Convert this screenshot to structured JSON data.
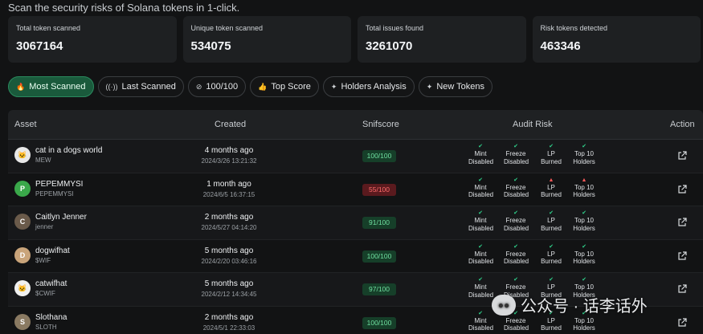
{
  "intro": "Scan the security risks of Solana tokens in 1-click.",
  "stats": [
    {
      "label": "Total token scanned",
      "value": "3067164"
    },
    {
      "label": "Unique token scanned",
      "value": "534075"
    },
    {
      "label": "Total issues found",
      "value": "3261070"
    },
    {
      "label": "Risk tokens detected",
      "value": "463346"
    }
  ],
  "filters": [
    {
      "label": "Most Scanned",
      "icon": "flame-icon",
      "active": true
    },
    {
      "label": "Last Scanned",
      "icon": "broadcast-icon",
      "active": false
    },
    {
      "label": "100/100",
      "icon": "check-circle-icon",
      "active": false
    },
    {
      "label": "Top Score",
      "icon": "thumbs-up-icon",
      "active": false
    },
    {
      "label": "Holders Analysis",
      "icon": "sparkle-icon",
      "active": false
    },
    {
      "label": "New Tokens",
      "icon": "sparkle-icon",
      "active": false
    }
  ],
  "columns": {
    "asset": "Asset",
    "created": "Created",
    "snifscore": "Snifscore",
    "audit": "Audit Risk",
    "action": "Action"
  },
  "audit_labels": {
    "mint": [
      "Mint",
      "Disabled"
    ],
    "freeze": [
      "Freeze",
      "Disabled"
    ],
    "lp": [
      "LP",
      "Burned"
    ],
    "top10": [
      "Top 10",
      "Holders"
    ]
  },
  "colors": {
    "ok": "#2fd08a",
    "warn": "#ff5a5a",
    "score_good_bg": "#163f29",
    "score_bad_bg": "#5a1a1e"
  },
  "rows": [
    {
      "name": "cat in a dogs world",
      "symbol": "MEW",
      "created_rel": "4 months ago",
      "created_abs": "2024/3/26 13:21:32",
      "score": "100/100",
      "score_status": "good",
      "audit": [
        "ok",
        "ok",
        "ok",
        "ok"
      ],
      "avatar_color": "#e8e8e8",
      "avatar_glyph": "🐱"
    },
    {
      "name": "PEPEMMYSI",
      "symbol": "PEPEMMYSI",
      "created_rel": "1 month ago",
      "created_abs": "2024/6/5 16:37:15",
      "score": "55/100",
      "score_status": "bad",
      "audit": [
        "ok",
        "ok",
        "warn",
        "warn"
      ],
      "avatar_color": "#3aa84a",
      "avatar_glyph": "P"
    },
    {
      "name": "Caitlyn Jenner",
      "symbol": "jenner",
      "created_rel": "2 months ago",
      "created_abs": "2024/5/27 04:14:20",
      "score": "91/100",
      "score_status": "good",
      "audit": [
        "ok",
        "ok",
        "ok",
        "ok"
      ],
      "avatar_color": "#6a5a4a",
      "avatar_glyph": "C"
    },
    {
      "name": "dogwifhat",
      "symbol": "$WIF",
      "created_rel": "5 months ago",
      "created_abs": "2024/2/20 03:46:16",
      "score": "100/100",
      "score_status": "good",
      "audit": [
        "ok",
        "ok",
        "ok",
        "ok"
      ],
      "avatar_color": "#c9a47a",
      "avatar_glyph": "D"
    },
    {
      "name": "catwifhat",
      "symbol": "$CWIF",
      "created_rel": "5 months ago",
      "created_abs": "2024/2/12 14:34:45",
      "score": "97/100",
      "score_status": "good",
      "audit": [
        "ok",
        "ok",
        "ok",
        "ok"
      ],
      "avatar_color": "#f0f0f0",
      "avatar_glyph": "🐱"
    },
    {
      "name": "Slothana",
      "symbol": "SLOTH",
      "created_rel": "2 months ago",
      "created_abs": "2024/5/1 22:33:03",
      "score": "100/100",
      "score_status": "good",
      "audit": [
        "ok",
        "ok",
        "ok",
        "ok"
      ],
      "avatar_color": "#8a7a62",
      "avatar_glyph": "S"
    }
  ],
  "watermark": {
    "text": "公众号 · 话李话外",
    "icon": "wechat-icon"
  }
}
